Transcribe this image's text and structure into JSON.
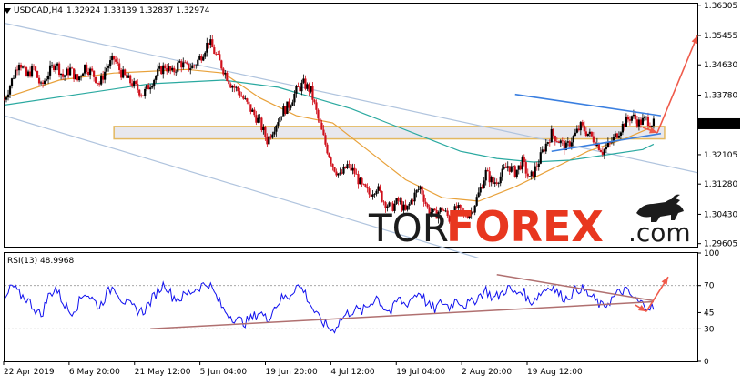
{
  "header": {
    "symbol": "USDCAD,H4",
    "ohlc": "1.32924 1.33139 1.32837 1.32974"
  },
  "rsi_header": "RSI(13) 48.9968",
  "watermark": {
    "left": "TOR",
    "right": "FOREX",
    "suffix": ".com"
  },
  "colors": {
    "bull": "#000000",
    "bear": "#d0101b",
    "ma_fast": "#e8a13a",
    "ma_slow": "#2aa9a0",
    "channel": "#b0c4de",
    "wedge": "#3a7fe0",
    "arrow": "#ef5a4a",
    "zone_fill": "#e8e8ee",
    "zone_border": "#e3b860",
    "rsi_line": "#1010ee",
    "rsi_trend": "#b07070",
    "logo_red": "#e8371f"
  },
  "chart_data": [
    {
      "type": "candlestick",
      "title": "USDCAD,H4",
      "ylim": [
        1.2952,
        1.3635
      ],
      "price_ticks": [
        "1.36305",
        "1.35455",
        "1.34630",
        "1.33780",
        "1.32974",
        "1.32105",
        "1.31280",
        "1.30430",
        "1.29605"
      ],
      "current_price": 1.32974,
      "x_labels": [
        "22 Apr 2019",
        "6 May 20:00",
        "21 May 12:00",
        "5 Jun 04:00",
        "19 Jun 20:00",
        "4 Jul 12:00",
        "19 Jul 04:00",
        "2 Aug 20:00",
        "19 Aug 12:00"
      ],
      "close_path": [
        [
          0,
          1.3365
        ],
        [
          4,
          1.342
        ],
        [
          8,
          1.3475
        ],
        [
          12,
          1.343
        ],
        [
          16,
          1.3455
        ],
        [
          20,
          1.34
        ],
        [
          24,
          1.344
        ],
        [
          28,
          1.347
        ],
        [
          32,
          1.343
        ],
        [
          36,
          1.345
        ],
        [
          40,
          1.342
        ],
        [
          44,
          1.346
        ],
        [
          48,
          1.344
        ],
        [
          52,
          1.341
        ],
        [
          56,
          1.3455
        ],
        [
          60,
          1.348
        ],
        [
          64,
          1.344
        ],
        [
          68,
          1.342
        ],
        [
          72,
          1.34
        ],
        [
          76,
          1.338
        ],
        [
          80,
          1.341
        ],
        [
          84,
          1.344
        ],
        [
          88,
          1.346
        ],
        [
          92,
          1.344
        ],
        [
          96,
          1.347
        ],
        [
          100,
          1.3455
        ],
        [
          104,
          1.346
        ],
        [
          108,
          1.349
        ],
        [
          112,
          1.353
        ],
        [
          116,
          1.349
        ],
        [
          120,
          1.345
        ],
        [
          124,
          1.341
        ],
        [
          128,
          1.339
        ],
        [
          132,
          1.336
        ],
        [
          136,
          1.333
        ],
        [
          140,
          1.33
        ],
        [
          144,
          1.325
        ],
        [
          148,
          1.329
        ],
        [
          152,
          1.333
        ],
        [
          156,
          1.335
        ],
        [
          160,
          1.339
        ],
        [
          164,
          1.341
        ],
        [
          168,
          1.339
        ],
        [
          172,
          1.331
        ],
        [
          176,
          1.324
        ],
        [
          180,
          1.318
        ],
        [
          184,
          1.315
        ],
        [
          188,
          1.318
        ],
        [
          192,
          1.316
        ],
        [
          196,
          1.312
        ],
        [
          200,
          1.31
        ],
        [
          204,
          1.312
        ],
        [
          208,
          1.308
        ],
        [
          212,
          1.306
        ],
        [
          216,
          1.308
        ],
        [
          220,
          1.305
        ],
        [
          224,
          1.309
        ],
        [
          228,
          1.312
        ],
        [
          232,
          1.306
        ],
        [
          236,
          1.304
        ],
        [
          240,
          1.306
        ],
        [
          244,
          1.303
        ],
        [
          248,
          1.306
        ],
        [
          252,
          1.304
        ],
        [
          256,
          1.305
        ],
        [
          260,
          1.31
        ],
        [
          264,
          1.316
        ],
        [
          268,
          1.313
        ],
        [
          272,
          1.315
        ],
        [
          276,
          1.318
        ],
        [
          280,
          1.316
        ],
        [
          284,
          1.319
        ],
        [
          288,
          1.314
        ],
        [
          292,
          1.318
        ],
        [
          296,
          1.323
        ],
        [
          300,
          1.327
        ],
        [
          304,
          1.325
        ],
        [
          308,
          1.323
        ],
        [
          312,
          1.326
        ],
        [
          316,
          1.329
        ],
        [
          320,
          1.327
        ],
        [
          324,
          1.325
        ],
        [
          328,
          1.322
        ],
        [
          332,
          1.324
        ],
        [
          336,
          1.327
        ],
        [
          340,
          1.33
        ],
        [
          344,
          1.332
        ],
        [
          348,
          1.33
        ],
        [
          352,
          1.331
        ],
        [
          356,
          1.3297
        ]
      ],
      "moving_averages": [
        {
          "name": "MA fast",
          "values": [
            [
              0,
              1.337
            ],
            [
              30,
              1.342
            ],
            [
              60,
              1.344
            ],
            [
              100,
              1.345
            ],
            [
              120,
              1.344
            ],
            [
              140,
              1.337
            ],
            [
              160,
              1.332
            ],
            [
              180,
              1.33
            ],
            [
              200,
              1.322
            ],
            [
              220,
              1.314
            ],
            [
              240,
              1.309
            ],
            [
              260,
              1.308
            ],
            [
              280,
              1.312
            ],
            [
              300,
              1.317
            ],
            [
              320,
              1.322
            ],
            [
              340,
              1.3255
            ],
            [
              356,
              1.329
            ]
          ]
        },
        {
          "name": "MA slow",
          "values": [
            [
              0,
              1.335
            ],
            [
              40,
              1.338
            ],
            [
              80,
              1.341
            ],
            [
              120,
              1.342
            ],
            [
              150,
              1.34
            ],
            [
              170,
              1.337
            ],
            [
              190,
              1.334
            ],
            [
              210,
              1.33
            ],
            [
              230,
              1.326
            ],
            [
              250,
              1.322
            ],
            [
              270,
              1.32
            ],
            [
              290,
              1.319
            ],
            [
              310,
              1.3195
            ],
            [
              330,
              1.321
            ],
            [
              350,
              1.3225
            ],
            [
              356,
              1.324
            ]
          ]
        }
      ],
      "channel_lines": [
        {
          "from": [
            0,
            1.358
          ],
          "to": [
            380,
            1.316
          ]
        },
        {
          "from": [
            0,
            1.332
          ],
          "to": [
            260,
            1.292
          ]
        }
      ],
      "resistance_zone": [
        1.3255,
        1.329
      ],
      "wedge": {
        "upper_from": [
          280,
          1.338
        ],
        "upper_to": [
          360,
          1.332
        ],
        "lower_from": [
          300,
          1.322
        ],
        "lower_to": [
          360,
          1.327
        ]
      }
    },
    {
      "type": "line",
      "title": "RSI(13) 48.9968",
      "ylim": [
        0,
        100
      ],
      "levels": [
        70,
        30
      ],
      "y_ticks": [
        "100",
        "70",
        "45",
        "30",
        "0"
      ],
      "values": [
        [
          0,
          55
        ],
        [
          4,
          70
        ],
        [
          8,
          62
        ],
        [
          12,
          58
        ],
        [
          16,
          50
        ],
        [
          20,
          42
        ],
        [
          24,
          60
        ],
        [
          28,
          68
        ],
        [
          32,
          55
        ],
        [
          36,
          45
        ],
        [
          40,
          52
        ],
        [
          44,
          64
        ],
        [
          48,
          58
        ],
        [
          52,
          50
        ],
        [
          56,
          62
        ],
        [
          60,
          70
        ],
        [
          64,
          58
        ],
        [
          68,
          52
        ],
        [
          72,
          48
        ],
        [
          76,
          46
        ],
        [
          80,
          55
        ],
        [
          84,
          65
        ],
        [
          88,
          72
        ],
        [
          92,
          60
        ],
        [
          96,
          58
        ],
        [
          100,
          62
        ],
        [
          104,
          66
        ],
        [
          108,
          70
        ],
        [
          112,
          72
        ],
        [
          116,
          60
        ],
        [
          120,
          48
        ],
        [
          124,
          42
        ],
        [
          128,
          38
        ],
        [
          132,
          36
        ],
        [
          136,
          40
        ],
        [
          140,
          46
        ],
        [
          144,
          38
        ],
        [
          148,
          50
        ],
        [
          152,
          58
        ],
        [
          156,
          60
        ],
        [
          160,
          70
        ],
        [
          164,
          66
        ],
        [
          168,
          52
        ],
        [
          172,
          40
        ],
        [
          176,
          34
        ],
        [
          180,
          28
        ],
        [
          184,
          38
        ],
        [
          188,
          44
        ],
        [
          192,
          48
        ],
        [
          196,
          46
        ],
        [
          200,
          52
        ],
        [
          204,
          60
        ],
        [
          208,
          50
        ],
        [
          212,
          45
        ],
        [
          216,
          58
        ],
        [
          220,
          52
        ],
        [
          224,
          60
        ],
        [
          228,
          64
        ],
        [
          232,
          52
        ],
        [
          236,
          48
        ],
        [
          240,
          55
        ],
        [
          244,
          50
        ],
        [
          248,
          58
        ],
        [
          252,
          52
        ],
        [
          256,
          54
        ],
        [
          260,
          60
        ],
        [
          264,
          66
        ],
        [
          268,
          58
        ],
        [
          272,
          62
        ],
        [
          276,
          68
        ],
        [
          280,
          62
        ],
        [
          284,
          66
        ],
        [
          288,
          54
        ],
        [
          292,
          60
        ],
        [
          296,
          66
        ],
        [
          300,
          70
        ],
        [
          304,
          62
        ],
        [
          308,
          58
        ],
        [
          312,
          64
        ],
        [
          316,
          68
        ],
        [
          320,
          62
        ],
        [
          324,
          56
        ],
        [
          328,
          50
        ],
        [
          332,
          56
        ],
        [
          336,
          62
        ],
        [
          340,
          66
        ],
        [
          344,
          60
        ],
        [
          348,
          54
        ],
        [
          352,
          52
        ],
        [
          356,
          49
        ]
      ],
      "trendlines": [
        {
          "from": [
            80,
            30
          ],
          "to": [
            356,
            55
          ]
        },
        {
          "from": [
            270,
            80
          ],
          "to": [
            356,
            56
          ]
        }
      ]
    }
  ]
}
